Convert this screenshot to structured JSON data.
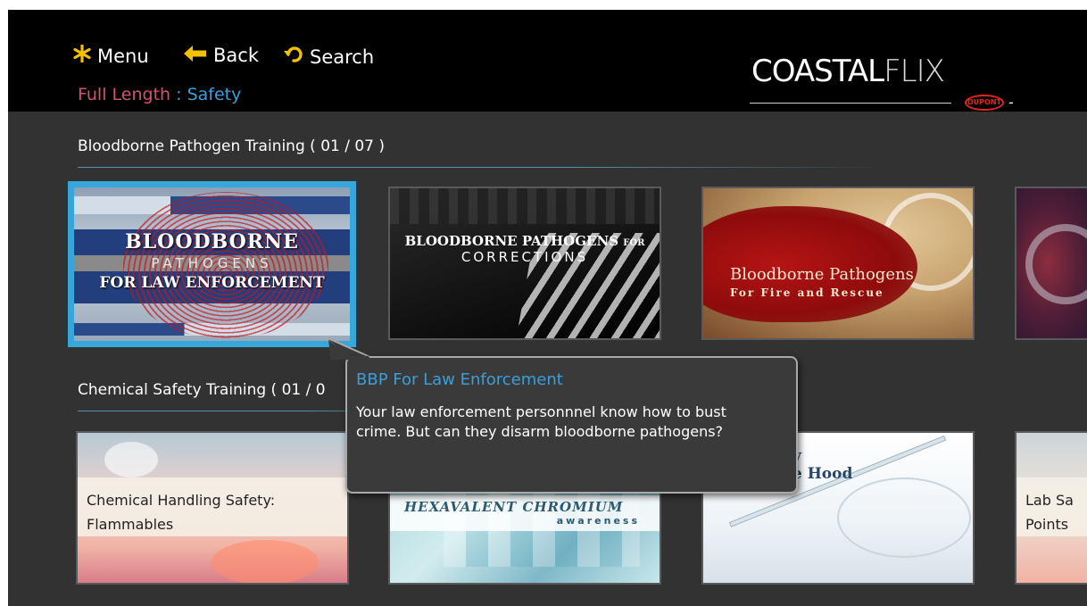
{
  "nav": {
    "menu_label": "Menu",
    "back_label": "Back",
    "search_label": "Search",
    "icon_color": "#f2c200"
  },
  "breadcrumb": {
    "category": "Full Length",
    "separator": " : ",
    "section": "Safety"
  },
  "logo": {
    "brand_bold": "COASTAL",
    "brand_thin": "FLIX",
    "partner": "DUPONT",
    "dash": "-"
  },
  "rows": [
    {
      "title": "Bloodborne Pathogen Training ( 01 / 07 )",
      "tiles": [
        {
          "line1": "BLOODBORNE",
          "line2": "PATHOGENS",
          "line3": "FOR LAW ENFORCEMENT",
          "selected": true
        },
        {
          "line1": "BLOODBORNE PATHOGENS",
          "line1_small": "FOR",
          "line2": "CORRECTIONS"
        },
        {
          "line1": "Bloodborne Pathogens",
          "line2": "For Fire and Rescue"
        },
        {
          "partial": true
        }
      ]
    },
    {
      "title": "Chemical Safety Training ( 01 / 0",
      "tiles": [
        {
          "line1": "Chemical Handling Safety:",
          "line2": "Flammables"
        },
        {
          "line1": "HEXAVALENT CHROMIUM",
          "line2": "awareness"
        },
        {
          "line1": "y",
          "line2": "e Hood"
        },
        {
          "line1": "Lab Sa",
          "line2": "Points"
        }
      ]
    }
  ],
  "tooltip": {
    "title": "BBP For Law Enforcement",
    "description": "Your law enforcement personnnel know how to bust crime. But can they disarm bloodborne pathogens?"
  },
  "colors": {
    "accent_blue": "#3a9fd8",
    "breadcrumb_pink": "#d1546f",
    "selection_border": "#35a7da",
    "background": "#323232",
    "header": "#000000"
  }
}
